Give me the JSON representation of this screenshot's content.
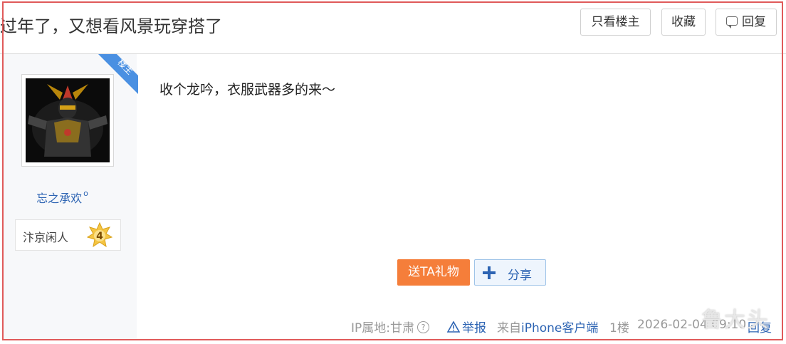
{
  "header": {
    "title": "过年了，又想看风景玩穿搭了",
    "only_op_label": "只看楼主",
    "favorite_label": "收藏",
    "reply_label": "回复"
  },
  "author": {
    "ribbon_label": "楼主",
    "username": "忘之承欢",
    "username_mark": "o",
    "level_title": "汴京闲人",
    "level_number": "4"
  },
  "post": {
    "content": "收个龙吟，衣服武器多的来～",
    "gift_label": "送TA礼物",
    "share_label": "分享"
  },
  "footer": {
    "ip_location": "IP属地:甘肃",
    "help_mark": "?",
    "report_label": "举报",
    "from_prefix": "来自",
    "client_label": "iPhone客户端",
    "floor": "1楼",
    "date": "2026-02-04 09:10",
    "reply_label": "回复"
  },
  "watermark": "鲁大头",
  "colors": {
    "link": "#2d64b3",
    "gift_button": "#f57e3a",
    "ribbon": "#4a90e2",
    "frame_highlight": "#e05a5a"
  }
}
